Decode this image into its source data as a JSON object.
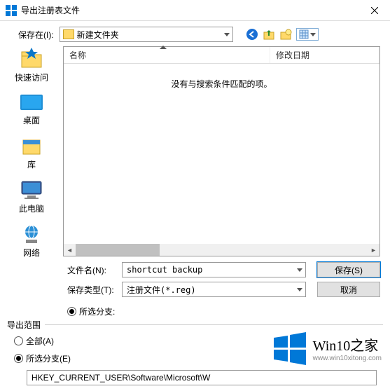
{
  "window": {
    "title": "导出注册表文件",
    "close_hint": "×"
  },
  "toolbar": {
    "save_in_label": "保存在(I):",
    "current_folder": "新建文件夹"
  },
  "sidebar": {
    "items": [
      {
        "label": "快速访问"
      },
      {
        "label": "桌面"
      },
      {
        "label": "库"
      },
      {
        "label": "此电脑"
      },
      {
        "label": "网络"
      }
    ]
  },
  "columns": {
    "name": "名称",
    "date": "修改日期"
  },
  "empty_text": "没有与搜索条件匹配的项。",
  "fields": {
    "filename_label": "文件名(N):",
    "filename_value": "shortcut backup",
    "filetype_label": "保存类型(T):",
    "filetype_value": "注册文件(*.reg)",
    "save_btn": "保存(S)",
    "cancel_btn": "取消",
    "selected_branch_inline": "所选分支:"
  },
  "scope": {
    "group_label": "导出范围",
    "all_label": "全部(A)",
    "selected_label": "所选分支(E)",
    "path": "HKEY_CURRENT_USER\\Software\\Microsoft\\W"
  },
  "watermark": {
    "brand1": "Win10",
    "brand2": "之家",
    "url": "www.win10xitong.com"
  }
}
